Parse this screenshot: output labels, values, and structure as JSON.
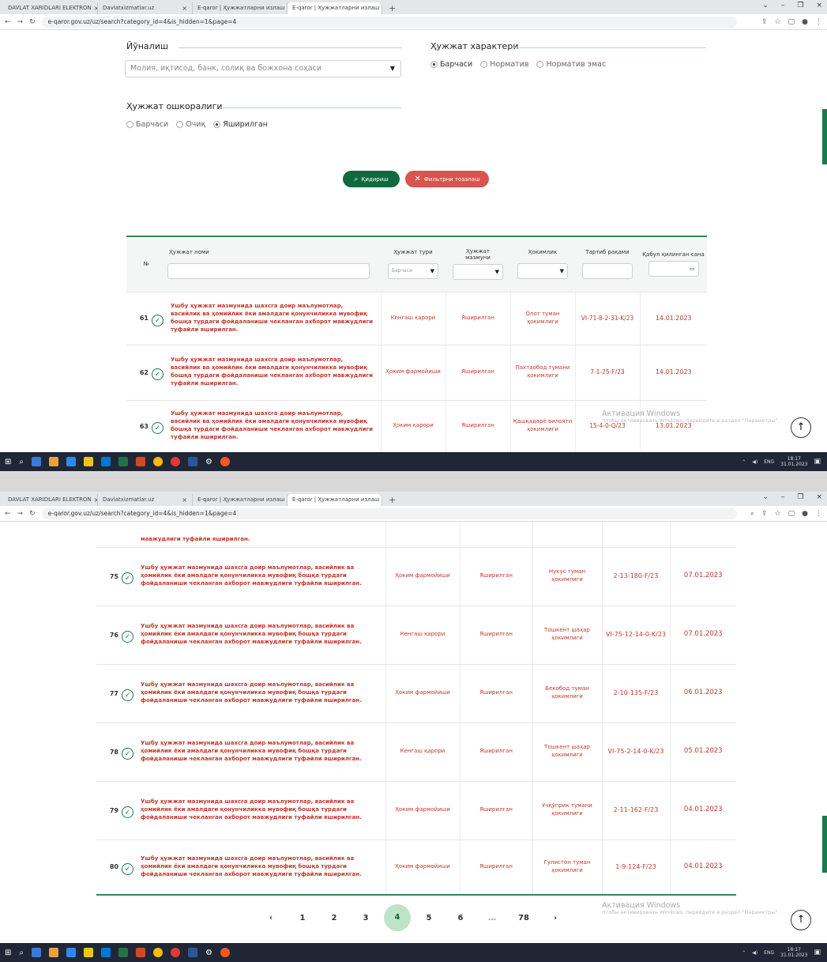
{
  "browser": {
    "tabs": [
      {
        "label": "DAVLAT XARIDLARI ELEKTRON"
      },
      {
        "label": "Davlatxizmatlar.uz"
      },
      {
        "label": "E-qaror | Ҳужжатларни излаш"
      },
      {
        "label": "E-qaror | Ҳужжатларни излаш"
      }
    ],
    "url": "e-qaror.gov.uz/uz/search?category_id=4&is_hidden=1&page=4"
  },
  "filters": {
    "direction_label": "Йўналиш",
    "direction_value": "Молия, иқтисод, банк, солиқ ва божхона соҳаси",
    "character_label": "Ҳужжат характери",
    "character_options": [
      "Барчаси",
      "Норматив",
      "Норматив эмас"
    ],
    "openness_label": "Ҳужжат ошкоралиги",
    "openness_options": [
      "Барчаси",
      "Очиқ",
      "Яширилган"
    ],
    "search_button": "Қидириш",
    "reset_button": "Фильтрни тозалаш"
  },
  "table": {
    "headers": {
      "no": "№",
      "name": "Ҳужжат номи",
      "type": "Ҳужжат тури",
      "content": "Ҳужжат мазмуни",
      "authority": "Ҳокимлик",
      "reg": "Тартиб рақами",
      "date": "Қабул қилинган сана"
    },
    "type_filter_value": "Барчаси",
    "rows_top": [
      {
        "no": "61",
        "name": "Ушбу ҳужжат мазмунида шахсга доир маълумотлар, васийлик ва ҳомийлик ёки амалдаги қонунчиликка мувофиқ бошқа турдаги фойдаланиши чекланган ахборот мавжудлиги туфайли яширилган.",
        "type": "Кенгаш қарори",
        "content": "Яширилган",
        "authority": "Олот туман ҳокимлиги",
        "reg": "VI-71-8-2-31-K/23",
        "date": "14.01.2023"
      },
      {
        "no": "62",
        "name": "Ушбу ҳужжат мазмунида шахсга доир маълумотлар, васийлик ва ҳомийлик ёки амалдаги қонунчиликка мувофиқ бошқа турдаги фойдаланиши чекланган ахборот мавжудлиги туфайли яширилган.",
        "type": "Ҳоким фармойиши",
        "content": "Яширилган",
        "authority": "Пахтаобод тумани ҳокимлиги",
        "reg": "7-1-25-F/23",
        "date": "14.01.2023"
      },
      {
        "no": "63",
        "name": "Ушбу ҳужжат мазмунида шахсга доир маълумотлар, васийлик ва ҳомийлик ёки амалдаги қонунчиликка мувофиқ бошқа турдаги фойдаланиши чекланган ахборот мавжудлиги туфайли яширилган.",
        "type": "Ҳоким қарори",
        "content": "Яширилган",
        "authority": "Қашқадарё вилояти ҳокимлиги",
        "reg": "15-4-0-Q/23",
        "date": "13.01.2023"
      }
    ],
    "partial_row_text": "мавжудлиги туфайли яширилган.",
    "rows_bottom": [
      {
        "no": "75",
        "name": "Ушбу ҳужжат мазмунида шахсга доир маълумотлар, васийлик ва ҳомийлик ёки амалдаги қонунчиликка мувофиқ бошқа турдаги фойдаланиши чекланган ахборот мавжудлиги туфайли яширилган.",
        "type": "Ҳоким фармойиши",
        "content": "Яширилган",
        "authority": "Нукус туман ҳокимлиги",
        "reg": "2-13-180-F/23",
        "date": "07.01.2023"
      },
      {
        "no": "76",
        "name": "Ушбу ҳужжат мазмунида шахсга доир маълумотлар, васийлик ва ҳомийлик ёки амалдаги қонунчиликка мувофиқ бошқа турдаги фойдаланиши чекланган ахборот мавжудлиги туфайли яширилган.",
        "type": "Кенгаш қарори",
        "content": "Яширилган",
        "authority": "Тошкент шаҳар ҳокимлиги",
        "reg": "VI-75-12-14-0-K/23",
        "date": "07.01.2023"
      },
      {
        "no": "77",
        "name": "Ушбу ҳужжат мазмунида шахсга доир маълумотлар, васийлик ва ҳомийлик ёки амалдаги қонунчиликка мувофиқ бошқа турдаги фойдаланиши чекланган ахборот мавжудлиги туфайли яширилган.",
        "type": "Ҳоким фармойиши",
        "content": "Яширилган",
        "authority": "Бекобод туман ҳокимлиги",
        "reg": "2-10-135-F/23",
        "date": "06.01.2023"
      },
      {
        "no": "78",
        "name": "Ушбу ҳужжат мазмунида шахсга доир маълумотлар, васийлик ва ҳомийлик ёки амалдаги қонунчиликка мувофиқ бошқа турдаги фойдаланиши чекланган ахборот мавжудлиги туфайли яширилган.",
        "type": "Кенгаш қарори",
        "content": "Яширилган",
        "authority": "Тошкент шаҳар ҳокимлиги",
        "reg": "VI-75-2-14-0-K/23",
        "date": "05.01.2023"
      },
      {
        "no": "79",
        "name": "Ушбу ҳужжат мазмунида шахсга доир маълумотлар, васийлик ва ҳомийлик ёки амалдаги қонунчиликка мувофиқ бошқа турдаги фойдаланиши чекланган ахборот мавжудлиги туфайли яширилган.",
        "type": "Ҳоким фармойиши",
        "content": "Яширилган",
        "authority": "Учқўприк тумани ҳокимлиги",
        "reg": "2-11-162-F/23",
        "date": "04.01.2023"
      },
      {
        "no": "80",
        "name": "Ушбу ҳужжат мазмунида шахсга доир маълумотлар, васийлик ва ҳомийлик ёки амалдаги қонунчиликка мувофиқ бошқа турдаги фойдаланиши чекланган ахборот мавжудлиги туфайли яширилган.",
        "type": "Ҳоким фармойиши",
        "content": "Яширилган",
        "authority": "Гулистон туман ҳокимлиги",
        "reg": "1-9-124-F/23",
        "date": "04.01.2023"
      }
    ]
  },
  "pagination": {
    "prev": "‹",
    "pages": [
      "1",
      "2",
      "3",
      "4",
      "5",
      "6",
      "…",
      "78"
    ],
    "active": "4",
    "next": "›"
  },
  "watermark": {
    "title": "Активация Windows",
    "subtitle": "Чтобы активировать Windows, перейдите в раздел \"Параметры\"."
  },
  "taskbar": {
    "time": "18:17",
    "date": "31.01.2023",
    "lang": "ENG"
  },
  "colors": {
    "brand_green": "#0f6b3d",
    "hidden_red": "#c0392b",
    "reset_red": "#d9534f"
  }
}
